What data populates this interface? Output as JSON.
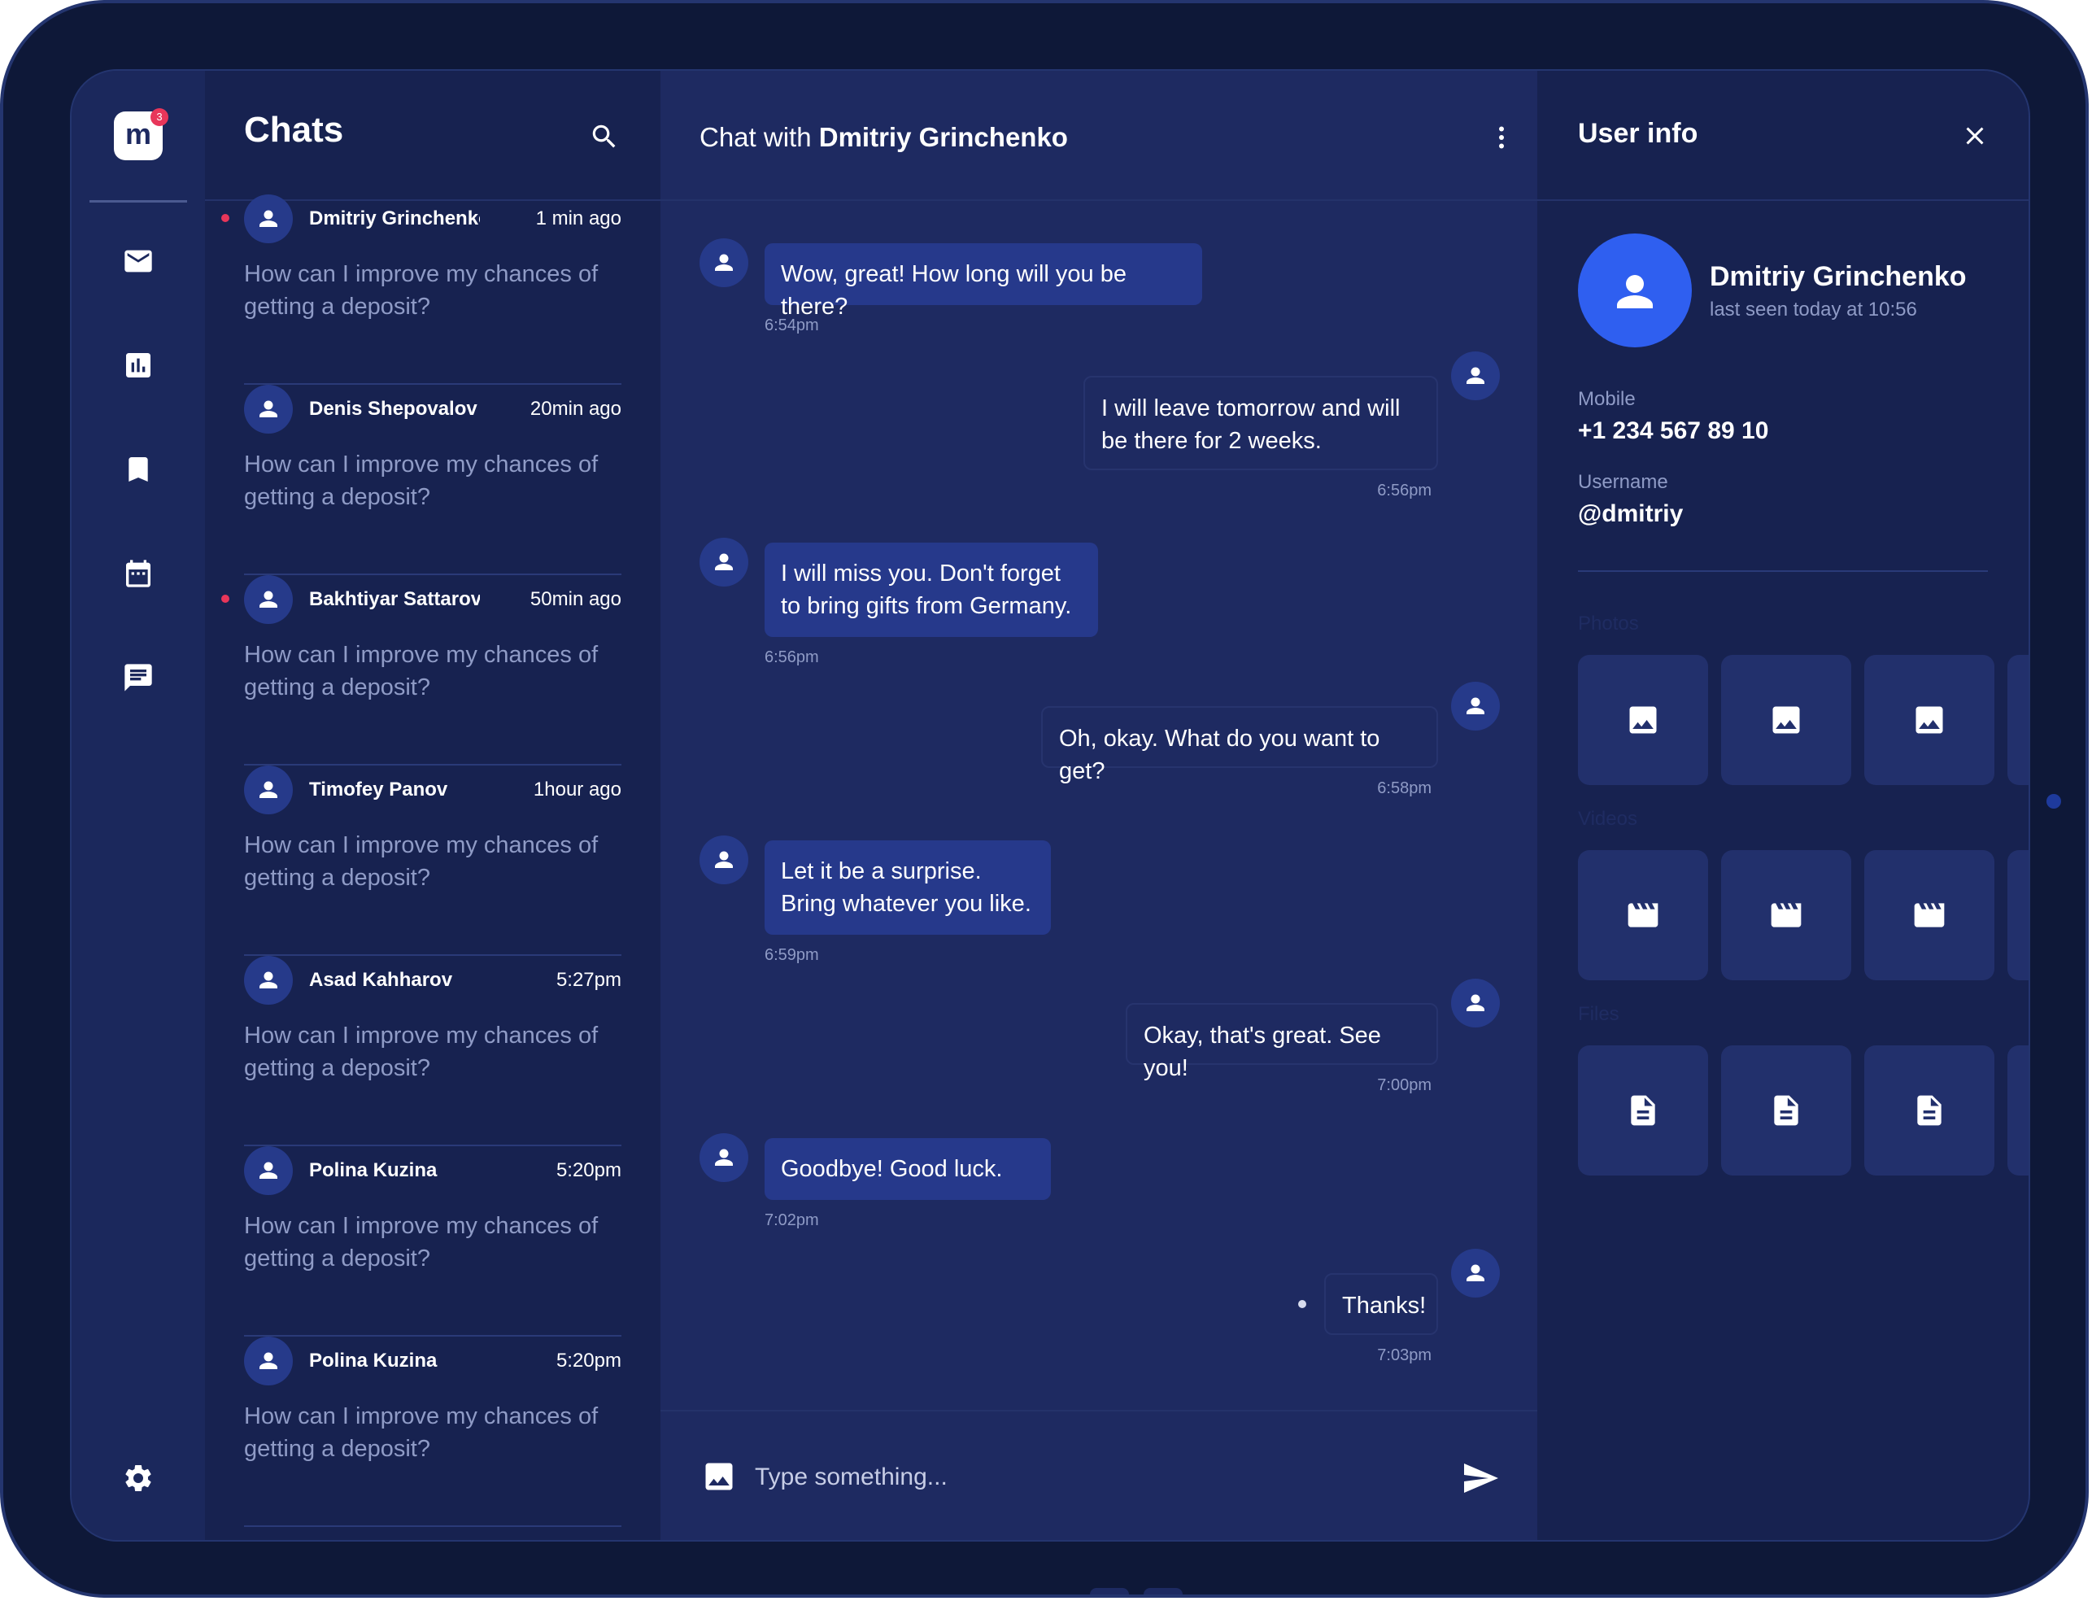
{
  "app": {
    "logo_letter": "m",
    "notification_count": "3"
  },
  "nav": {
    "items": [
      "mail-icon",
      "chart-icon",
      "bookmark-icon",
      "calendar-icon",
      "chat-icon"
    ],
    "settings": "gear-icon"
  },
  "chats": {
    "title": "Chats",
    "items": [
      {
        "name": "Dmitriy Grinchenko",
        "time": "1 min ago",
        "preview": "How can I improve my chances of getting a deposit?",
        "unread": true
      },
      {
        "name": "Denis Shepovalov",
        "time": "20min ago",
        "preview": "How can I improve my chances of getting a deposit?",
        "unread": false
      },
      {
        "name": "Bakhtiyar Sattarov",
        "time": "50min ago",
        "preview": "How can I improve my chances of getting a deposit?",
        "unread": true
      },
      {
        "name": "Timofey Panov",
        "time": "1hour ago",
        "preview": "How can I improve my chances of getting a deposit?",
        "unread": false
      },
      {
        "name": "Asad Kahharov",
        "time": "5:27pm",
        "preview": "How can I improve my chances of getting a deposit?",
        "unread": false
      },
      {
        "name": "Polina Kuzina",
        "time": "5:20pm",
        "preview": "How can I improve my chances of getting a deposit?",
        "unread": false
      },
      {
        "name": "Polina Kuzina",
        "time": "5:20pm",
        "preview": "How can I improve my chances of getting a deposit?",
        "unread": false
      }
    ]
  },
  "conversation": {
    "title_prefix": "Chat with ",
    "contact_name": "Dmitriy Grinchenko",
    "messages": [
      {
        "direction": "in",
        "text": "Wow, great! How long will you be there?",
        "time": "6:54pm"
      },
      {
        "direction": "out",
        "text": "I will leave tomorrow and will be there for 2 weeks.",
        "time": "6:56pm"
      },
      {
        "direction": "in",
        "text": "I will miss you. Don't forget to bring gifts from Germany.",
        "time": "6:56pm"
      },
      {
        "direction": "out",
        "text": "Oh, okay. What do you want to get?",
        "time": "6:58pm"
      },
      {
        "direction": "in",
        "text": "Let it be a surprise. Bring whatever you like.",
        "time": "6:59pm"
      },
      {
        "direction": "out",
        "text": "Okay, that's great. See you!",
        "time": "7:00pm"
      },
      {
        "direction": "in",
        "text": "Goodbye! Good luck.",
        "time": "7:02pm"
      },
      {
        "direction": "out",
        "text": "Thanks!",
        "time": "7:03pm"
      }
    ],
    "composer": {
      "placeholder": "Type something..."
    }
  },
  "user_info": {
    "title": "User info",
    "name": "Dmitriy Grinchenko",
    "last_seen": "last seen today at 10:56",
    "mobile_label": "Mobile",
    "mobile": "+1 234 567 89 10",
    "username_label": "Username",
    "username": "@dmitriy",
    "sections": [
      "Photos",
      "Videos",
      "Files"
    ]
  },
  "colors": {
    "frame": "#0e1838",
    "screen": "#1e2a61",
    "panel": "#172250",
    "accent": "#2f5ff0",
    "unread": "#e8365a"
  }
}
